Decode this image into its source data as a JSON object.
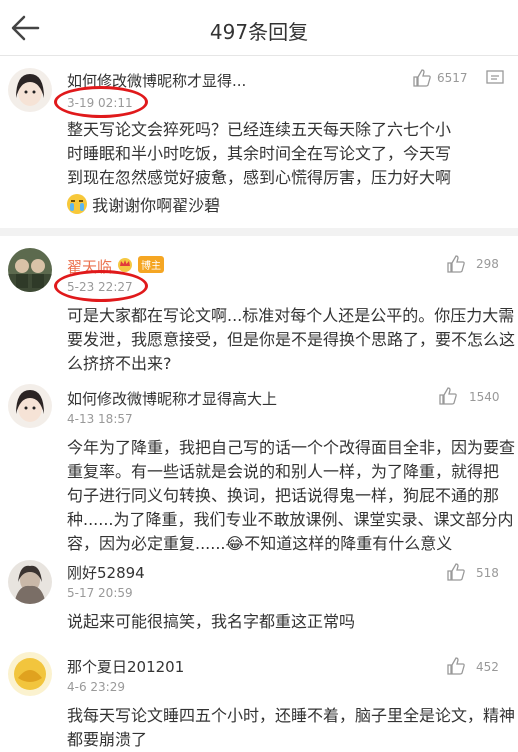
{
  "header": {
    "title": "497条回复"
  },
  "comments": [
    {
      "name": "如何修改微博昵称才显得...",
      "time": "3-19 02:11",
      "likes": "6517",
      "text_line1": "整天写论文会猝死吗？已经连续五天每天除了六七个小",
      "text_line2": "时睡眠和半小时吃饭，其余时间全在写论文了，今天写",
      "text_line3": "到现在忽然感觉好疲惫，感到心慌得厉害，压力好大啊",
      "text_line4": "我谢谢你啊翟沙碧"
    },
    {
      "name": "翟天临",
      "badge": "博主",
      "time": "5-23 22:27",
      "likes": "298",
      "text_line1": "可是大家都在写论文啊...标准对每个人还是公平的。你压力大需",
      "text_line2": "要发泄，我愿意接受，但是你是不是得换个思路了，要不怎么这",
      "text_line3": "么挤挤不出来?"
    },
    {
      "name": "如何修改微博昵称才显得高大上",
      "time": "4-13 18:57",
      "likes": "1540",
      "text_line1": "今年为了降重，我把自己写的话一个个改得面目全非，因为要查",
      "text_line2": "重复率。有一些话就是会说的和别人一样，为了降重，就得把",
      "text_line3": "句子进行同义句转换、换词，把话说得鬼一样，狗屁不通的那",
      "text_line4": "种......为了降重，我们专业不敢放课例、课堂实录、课文部分内",
      "text_line5": "容，因为必定重复......😂不知道这样的降重有什么意义"
    },
    {
      "name": "刚好52894",
      "time": "5-17 20:59",
      "likes": "518",
      "text_line1": "说起来可能很搞笑，我名字都重这正常吗"
    },
    {
      "name": "那个夏日201201",
      "time": "4-6 23:29",
      "likes": "452",
      "text_line1": "我每天写论文睡四五个小时，还睡不着，脑子里全是论文，精神",
      "text_line2": "都要崩溃了"
    }
  ],
  "colors": {
    "accent": "#eb7350",
    "annotation": "#e0191b",
    "badge": "#f5a623"
  }
}
